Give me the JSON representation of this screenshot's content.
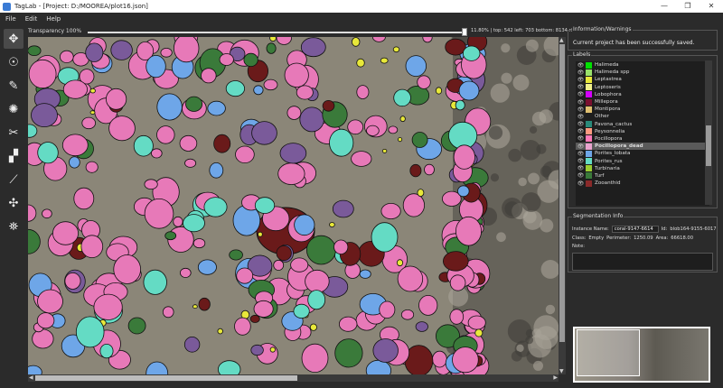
{
  "window": {
    "title": "TagLab - [Project: D:/MOOREA/plot16.json]",
    "minimize": "—",
    "maximize": "❐",
    "close": "✕"
  },
  "menu": [
    "File",
    "Edit",
    "Help"
  ],
  "toolbar": [
    {
      "icon": "move-icon",
      "glyph": "✥",
      "active": true
    },
    {
      "icon": "extreme-points-icon",
      "glyph": "☉",
      "active": false
    },
    {
      "icon": "freehand-icon",
      "glyph": "✎",
      "active": false
    },
    {
      "icon": "watershed-icon",
      "glyph": "✺",
      "active": false
    },
    {
      "icon": "cut-icon",
      "glyph": "✂",
      "active": false
    },
    {
      "icon": "assign-icon",
      "glyph": "▞",
      "active": false
    },
    {
      "icon": "ruler-icon",
      "glyph": "⟋",
      "active": false
    },
    {
      "icon": "split-icon",
      "glyph": "✣",
      "active": false
    },
    {
      "icon": "deep-extreme-icon",
      "glyph": "⛯",
      "active": false
    }
  ],
  "transparency": {
    "label": "Transparency 100%",
    "info": "11.80% | top: 542 left: 703 bottom: 8134 right: 12582"
  },
  "info_panel": {
    "title": "Information/Warnings",
    "message": "Current project has been successfully saved."
  },
  "labels_panel": {
    "title": "Labels",
    "items": [
      {
        "name": "Halimeda",
        "color": "#00e000",
        "selected": false
      },
      {
        "name": "Halimeda spp",
        "color": "#9ae26a",
        "selected": false
      },
      {
        "name": "Leptastrea",
        "color": "#e8e83a",
        "selected": false
      },
      {
        "name": "Leptoseris",
        "color": "#f0f08a",
        "selected": false
      },
      {
        "name": "Lobophora",
        "color": "#d400ff",
        "selected": false
      },
      {
        "name": "Millepora",
        "color": "#7a1030",
        "selected": false
      },
      {
        "name": "Montipora",
        "color": "#e0c070",
        "selected": false
      },
      {
        "name": "Other",
        "color": "#1e1e1e",
        "selected": false
      },
      {
        "name": "Pavona_cactus",
        "color": "#2a8a7a",
        "selected": false
      },
      {
        "name": "Peysonnelia",
        "color": "#ff9a80",
        "selected": false
      },
      {
        "name": "Pocillopora",
        "color": "#ff7ab8",
        "selected": false
      },
      {
        "name": "Pocillopora_dead",
        "color": "#e9a4cf",
        "selected": true
      },
      {
        "name": "Porites_lobata",
        "color": "#6ea6e8",
        "selected": false
      },
      {
        "name": "Porites_rus",
        "color": "#64dbc4",
        "selected": false
      },
      {
        "name": "Turbinaria",
        "color": "#9acd32",
        "selected": false
      },
      {
        "name": "Turf",
        "color": "#3a7a3a",
        "selected": false
      },
      {
        "name": "Zooanthid",
        "color": "#8a2a2a",
        "selected": false
      }
    ]
  },
  "segmentation": {
    "title": "Segmentation Info",
    "instance_label": "Instance Name:",
    "instance_name": "coral-9147-6614",
    "id_label": "Id:",
    "id": "blob164-9155-6017",
    "class_label": "Class:",
    "class": "Empty",
    "perimeter_label": "Perimeter:",
    "perimeter": "1250.09",
    "area_label": "Area:",
    "area": "66618.00",
    "note_label": "Note:"
  },
  "colors": {
    "pocillopora": "#e779b8",
    "porites_rus": "#64dbc4",
    "porites_lobata": "#6ea6e8",
    "zooanthid": "#6a1a1a",
    "lobophora": "#7a5a9a",
    "turf": "#3a7a3a",
    "halimeda": "#e8e83a",
    "substrate": "#8b8678"
  }
}
